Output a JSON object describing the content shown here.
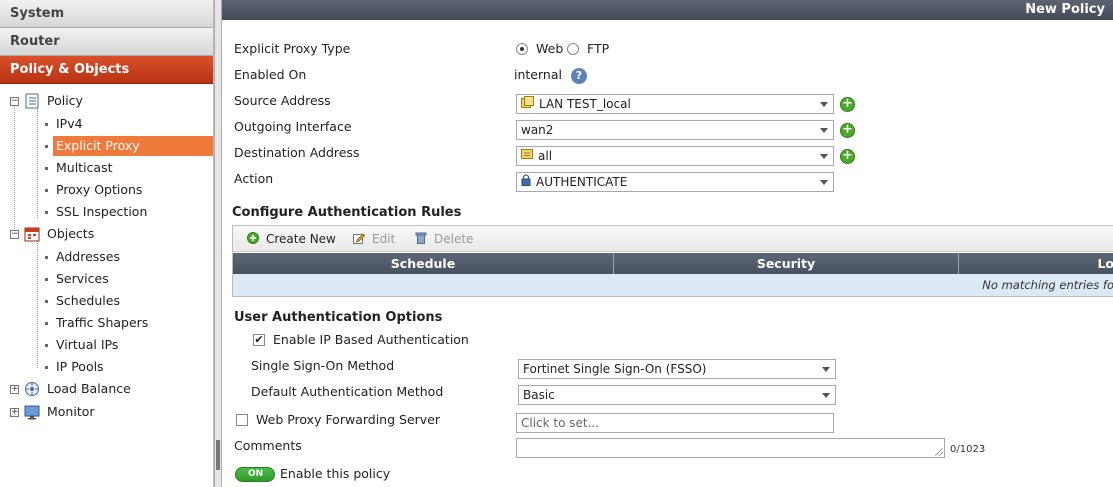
{
  "nav": {
    "sections": [
      "System",
      "Router",
      "Policy & Objects"
    ]
  },
  "tree": {
    "policy": "Policy",
    "policy_children": [
      "IPv4",
      "Explicit Proxy",
      "Multicast",
      "Proxy Options",
      "SSL Inspection"
    ],
    "objects": "Objects",
    "objects_children": [
      "Addresses",
      "Services",
      "Schedules",
      "Traffic Shapers",
      "Virtual IPs",
      "IP Pools"
    ],
    "load_balance": "Load Balance",
    "monitor": "Monitor",
    "selected": "Explicit Proxy"
  },
  "header": {
    "title": "New Policy"
  },
  "form": {
    "proxy_type_label": "Explicit Proxy Type",
    "proxy_type_web": "Web",
    "proxy_type_ftp": "FTP",
    "enabled_on_label": "Enabled On",
    "enabled_on_value": "internal",
    "source_label": "Source Address",
    "source_value": "LAN TEST_local",
    "outgoing_label": "Outgoing Interface",
    "outgoing_value": "wan2",
    "dest_label": "Destination Address",
    "dest_value": "all",
    "action_label": "Action",
    "action_value": "AUTHENTICATE"
  },
  "rules": {
    "title": "Configure Authentication Rules",
    "create_new": "Create New",
    "edit": "Edit",
    "delete": "Delete",
    "columns": [
      "Schedule",
      "Security",
      "Lo"
    ],
    "empty_text": "No matching entries fo"
  },
  "user_auth": {
    "title": "User Authentication Options",
    "ip_based_label": "Enable IP Based Authentication",
    "sso_label": "Single Sign-On Method",
    "sso_value": "Fortinet Single Sign-On (FSSO)",
    "default_method_label": "Default Authentication Method",
    "default_method_value": "Basic",
    "forwarding_label": "Web Proxy Forwarding Server",
    "forwarding_placeholder": "Click to set...",
    "comments_label": "Comments",
    "comments_counter": "0/1023",
    "toggle_label": "ON",
    "enable_policy_label": "Enable this policy"
  },
  "colors": {
    "nav_active": "#c23e17",
    "tree_selected": "#f07a3c",
    "add_button": "#4caa28",
    "toggle_on": "#3aa935"
  }
}
